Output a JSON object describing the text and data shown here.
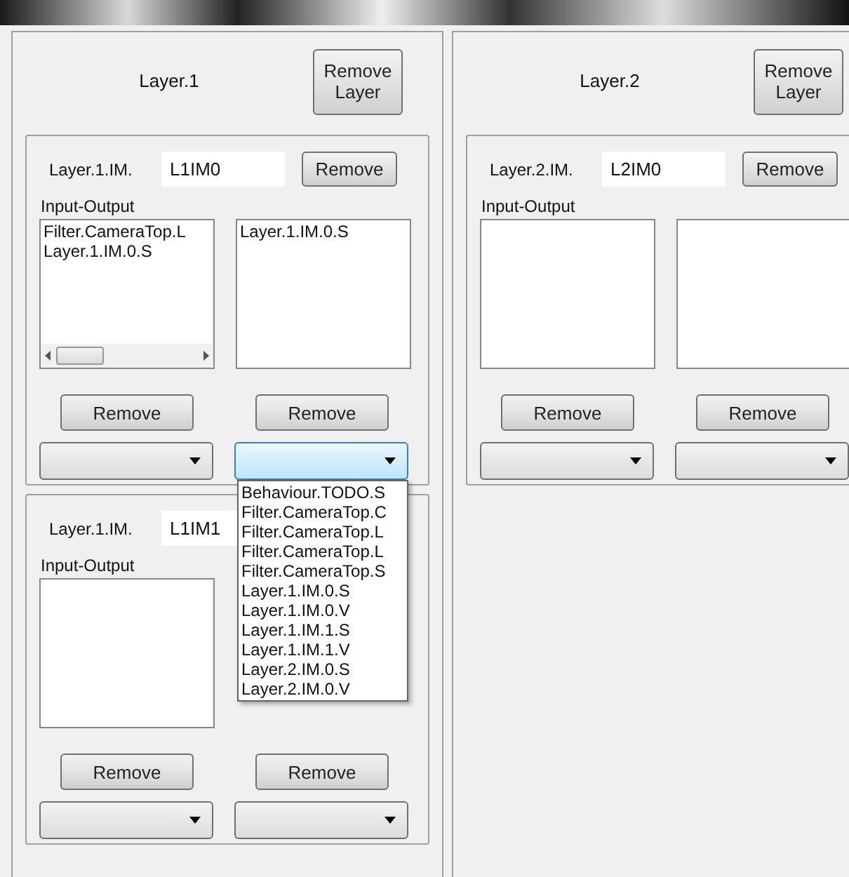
{
  "layers": [
    {
      "title": "Layer.1",
      "remove_button": "Remove\nLayer",
      "modules": [
        {
          "label": "Layer.1.IM.",
          "name_value": "L1IM0",
          "remove_button": "Remove",
          "io_label": "Input-Output",
          "lists": [
            {
              "items": [
                "Filter.CameraTop.L",
                "Layer.1.IM.0.S"
              ],
              "hscroll": true,
              "kind": "listbox"
            },
            {
              "items": [
                "Layer.1.IM.0.S"
              ],
              "kind": "listbox"
            }
          ],
          "list_buttons": [
            "Remove",
            "Remove"
          ],
          "combos": [
            {
              "expanded": false
            },
            {
              "expanded": true,
              "options": [
                "Behaviour.TODO.S",
                "Filter.CameraTop.C",
                "Filter.CameraTop.L",
                "Filter.CameraTop.L",
                "Filter.CameraTop.S",
                "Layer.1.IM.0.S",
                "Layer.1.IM.0.V",
                "Layer.1.IM.1.S",
                "Layer.1.IM.1.V",
                "Layer.2.IM.0.S",
                "Layer.2.IM.0.V"
              ]
            }
          ]
        },
        {
          "label": "Layer.1.IM.",
          "name_value": "L1IM1",
          "io_label": "Input-Output",
          "lists": [
            {
              "kind": "listbox"
            }
          ],
          "list_buttons": [
            "Remove",
            "Remove"
          ],
          "combos": [
            {
              "expanded": false
            },
            {
              "expanded": false
            }
          ]
        }
      ]
    },
    {
      "title": "Layer.2",
      "remove_button": "Remove\nLayer",
      "modules": [
        {
          "label": "Layer.2.IM.",
          "name_value": "L2IM0",
          "remove_button": "Remove",
          "io_label": "Input-Output",
          "lists": [
            {
              "kind": "listbox"
            },
            {
              "kind": "listbox"
            }
          ],
          "list_buttons": [
            "Remove",
            "Remove"
          ],
          "combos": [
            {
              "expanded": false
            },
            {
              "expanded": false
            }
          ]
        }
      ]
    }
  ]
}
